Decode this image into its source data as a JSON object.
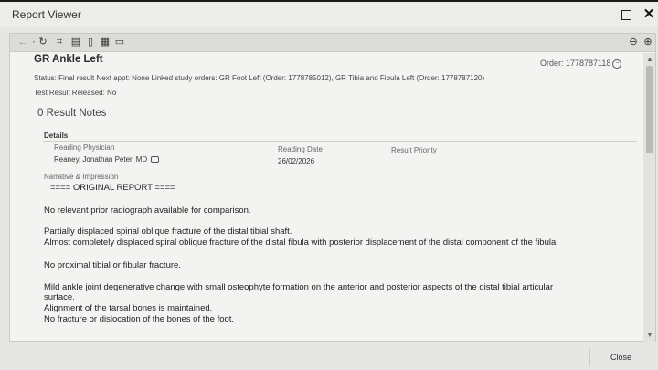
{
  "window": {
    "title": "Report Viewer"
  },
  "report": {
    "title": "GR Ankle Left",
    "order": "Order: 1778787118",
    "status_line": "Status: Final result   Next appt: None   Linked study orders: GR Foot Left (Order: 1778785012), GR Tibia and Fibula Left (Order: 1778787120)",
    "released": "Test Result Released: No",
    "result_notes": "0  Result Notes",
    "details": {
      "heading": "Details",
      "reading_physician_label": "Reading Physician",
      "reading_physician": "Reaney, Jonathan Peter, MD",
      "reading_date_label": "Reading Date",
      "reading_date": "26/02/2026",
      "result_priority_label": "Result Priority"
    },
    "narrative_label": "Narrative & Impression",
    "narrative": [
      "==== ORIGINAL REPORT ====",
      "No relevant prior radiograph available for comparison.",
      "Partially displaced spinal oblique fracture of the distal tibial shaft.",
      "Almost completely displaced spiral oblique fracture of the distal fibula with posterior displacement of the distal component of the fibula.",
      "No proximal tibial or fibular fracture.",
      "Mild ankle joint degenerative change with small osteophyte formation on the anterior and posterior aspects of the distal tibial articular",
      "surface.",
      "Alignment of the tarsal bones is maintained.",
      "No fracture or dislocation of the bones of the foot."
    ]
  },
  "footer": {
    "close_label": "Close"
  },
  "icons": [
    "back-icon",
    "refresh-icon",
    "binoculars-icon",
    "print-icon",
    "copy-icon",
    "export-icon",
    "link-icon",
    "zoom-out-icon",
    "zoom-in-icon"
  ]
}
